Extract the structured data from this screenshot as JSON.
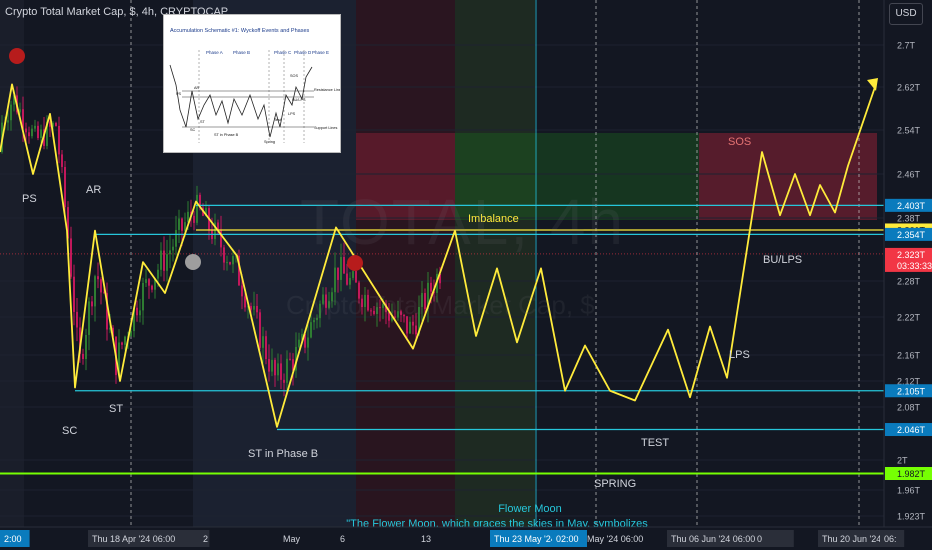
{
  "header": {
    "symbol_title": "Crypto Total Market Cap, $, 4h, CRYPTOCAP",
    "currency_button": "USD"
  },
  "watermark": {
    "ticker": "TOTAL, 4h",
    "name": "Crypto Total Market Cap, $"
  },
  "inset": {
    "title": "Accumulation Schematic #1: Wyckoff Events and Phases",
    "phases": [
      "Phase A",
      "Phase B",
      "Phase C",
      "Phase D",
      "Phase E"
    ],
    "labels": [
      "PS",
      "SC",
      "AR",
      "ST",
      "ST in Phase B",
      "Spring",
      "Test",
      "LPS",
      "SOS",
      "BU/LPS",
      "Resistance Lines",
      "Support Lines"
    ]
  },
  "colors": {
    "background": "#131722",
    "path": "#ffeb3b",
    "cyan_line": "#26c6da",
    "green_line": "#76ff03",
    "up_candle": "#c2185b",
    "down_candle": "#2e7d32",
    "red_zone": "#7b1f33",
    "green_zone": "#1b5e20",
    "price_label_bg": "#0a7bbd",
    "current_price_bg": "#f23645"
  },
  "chart_data": {
    "type": "line",
    "title": "Crypto Total Market Cap, $, 4h, CRYPTOCAP",
    "y_unit": "T",
    "ylim": [
      1.9,
      2.76
    ],
    "y_ticks": [
      "2.7T",
      "2.62T",
      "2.54T",
      "2.46T",
      "2.38T",
      "2.28T",
      "2.22T",
      "2.16T",
      "2.12T",
      "2.08T",
      "2T",
      "1.96T",
      "1.923T"
    ],
    "x_ticks": [
      "2:00",
      "Thu 18 Apr '24  06:00",
      "2",
      "May",
      "6",
      "13",
      "Thu 23 May '24",
      "02:00",
      "May '24  06:00",
      "Thu 06 Jun '24   06:00",
      "0",
      "Thu 20 Jun '24",
      "06:"
    ],
    "highlighted_x_ticks": [
      "Thu 23 May '24",
      "02:00"
    ],
    "horizontal_levels": [
      {
        "label": "2.403T",
        "value": 2.403,
        "color": "#26c6da"
      },
      {
        "label": "2.361T",
        "value": 2.361,
        "color": "#ffeb3b"
      },
      {
        "label": "2.354T",
        "value": 2.354,
        "color": "#26c6da"
      },
      {
        "label": "2.323T",
        "value": 2.323,
        "color": "#f23645",
        "sub": "03:33:33"
      },
      {
        "label": "2.105T",
        "value": 2.105,
        "color": "#26c6da"
      },
      {
        "label": "2.046T",
        "value": 2.046,
        "color": "#26c6da"
      },
      {
        "label": "1.982T",
        "value": 1.982,
        "color": "#76ff03"
      }
    ],
    "wyckoff_path": {
      "x": [
        0,
        12,
        33,
        50,
        67,
        75,
        95,
        120,
        143,
        165,
        196,
        237,
        277,
        336,
        413,
        455,
        476,
        497,
        517,
        541,
        565,
        585,
        610,
        635,
        668,
        690,
        710,
        727,
        762,
        780,
        795,
        810,
        820,
        835,
        848,
        875
      ],
      "y": [
        2.5,
        2.625,
        2.46,
        2.57,
        2.36,
        2.11,
        2.36,
        2.12,
        2.31,
        2.26,
        2.41,
        2.32,
        2.05,
        2.365,
        2.17,
        2.36,
        2.19,
        2.3,
        2.18,
        2.3,
        2.105,
        2.175,
        2.105,
        2.09,
        2.2,
        2.095,
        2.205,
        2.125,
        2.5,
        2.385,
        2.46,
        2.385,
        2.44,
        2.39,
        2.475,
        2.62
      ]
    },
    "annotations": [
      "PS",
      "AR",
      "SC",
      "ST",
      "ST in Phase B",
      "Imbalance",
      "SOS",
      "BU/LPS",
      "LPS",
      "TEST",
      "SPRING"
    ],
    "footnote_title": "Flower Moon",
    "footnote_text": "\"The Flower Moon, which graces the skies in May, symbolizes"
  }
}
